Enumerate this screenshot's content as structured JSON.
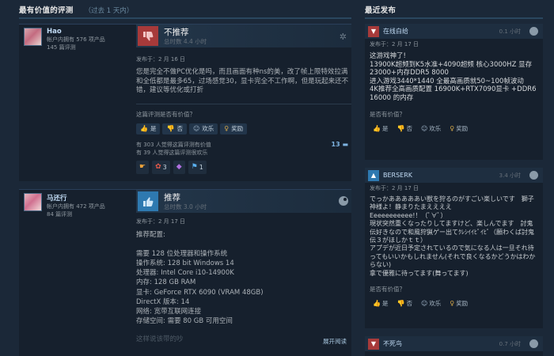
{
  "left": {
    "title": "最有价值的评测",
    "subtitle": "（过去 1 天内）"
  },
  "right": {
    "title": "最近发布"
  },
  "reviews": [
    {
      "author": "Hao",
      "products": "帐户内拥有 576 项产品",
      "review_count": "145 篇评测",
      "verdict": "不推荐",
      "hours": "总时数 4.4 小时",
      "posted": "发布于：2 月 16 日",
      "text": "您是完全不做PC优化是吗，而且画面有种ns的美，改了帧上限特效拉满和全低都是最多65，过场感觉30，显卡完全不工作啊，但是玩起来还不错，建议等优化或打折",
      "helpful_q": "这篇评测是否有价值？",
      "buttons": [
        "是",
        "否",
        "欢乐",
        "奖励"
      ],
      "stat1": "有 303 人觉得这篇评测有价值",
      "stat2": "有 39 人觉得这篇评测很欢乐",
      "comments": "13",
      "awards": [
        {
          "icon": "hand-point-award-icon",
          "glyph": "☛",
          "color": "#e8a03a",
          "count": ""
        },
        {
          "icon": "chicken-award-icon",
          "glyph": "✿",
          "color": "#e85a4a",
          "count": "3"
        },
        {
          "icon": "purple-award-icon",
          "glyph": "◆",
          "color": "#b070e0",
          "count": ""
        },
        {
          "icon": "blue-award-icon",
          "glyph": "⚑",
          "color": "#5ab0f0",
          "count": "1"
        }
      ]
    },
    {
      "author": "马还行",
      "products": "帐户内拥有 472 项产品",
      "review_count": "84 篇评测",
      "verdict": "推荐",
      "hours": "总时数 3.0 小时",
      "posted": "发布于：2 月 17 日",
      "text": "推荐配置:\n\n需要 128 位处理器和操作系统\n操作系统: 128 bit Windows 14\n处理器: Intel Core i10-14900K\n内存: 128 GB RAM\n显卡: GeForce RTX 6090 (VRAM 48GB)\nDirectX 版本: 14\n网络: 宽带互联网连接\n存储空间: 需要 80 GB 可用空间",
      "faded": "这样说该带的吵",
      "read_more": "展开阅读"
    }
  ],
  "recent": [
    {
      "author": "在线白给",
      "hours": "0.1 小时",
      "posted": "发布于：2 月 17 日",
      "text": "这游戏神了!\n13900K超频到K5水准+4090超频 核心3000HZ 显存23000+内存DDR5 8000\n进入游戏3440*1440 全最高画质就50~100帧波动\n4K推荐全高画质配置 16900K+RTX7090显卡 +DDR6 16000 的内存",
      "helpful_q": "是否有价值？",
      "buttons": [
        "是",
        "否",
        "欢乐",
        "奖励"
      ]
    },
    {
      "author": "BERSERK",
      "hours": "3.4 小时",
      "posted": "发布于：2 月 17 日",
      "text": "でっかあああああい獣を狩るのがすごい楽しいです　獅子神様よ！静まりたまええええ\nEeeeeeeeeee!！（ﾟ∀ﾟ）\n現状突然重くなったりしてますけど、楽しんでます　討鬼伝好きなので和風狩猟ゲー出てｸﾚｼｲｲﾋﾟｲﾋﾟ（願わくば討鬼伝３がほしかｔｔ）\nアプデが近日予定されているので気になる人は一旦それ待ってもいいかもしれません(それで良くなるかどうかはわからない)\n拿で優雅に待ってます(舞ってます)",
      "helpful_q": "是否有价值？",
      "buttons": [
        "是",
        "否",
        "欢乐",
        "奖励"
      ]
    },
    {
      "author": "不死鸟",
      "hours": "0.7 小时",
      "posted": "",
      "text": ""
    }
  ]
}
